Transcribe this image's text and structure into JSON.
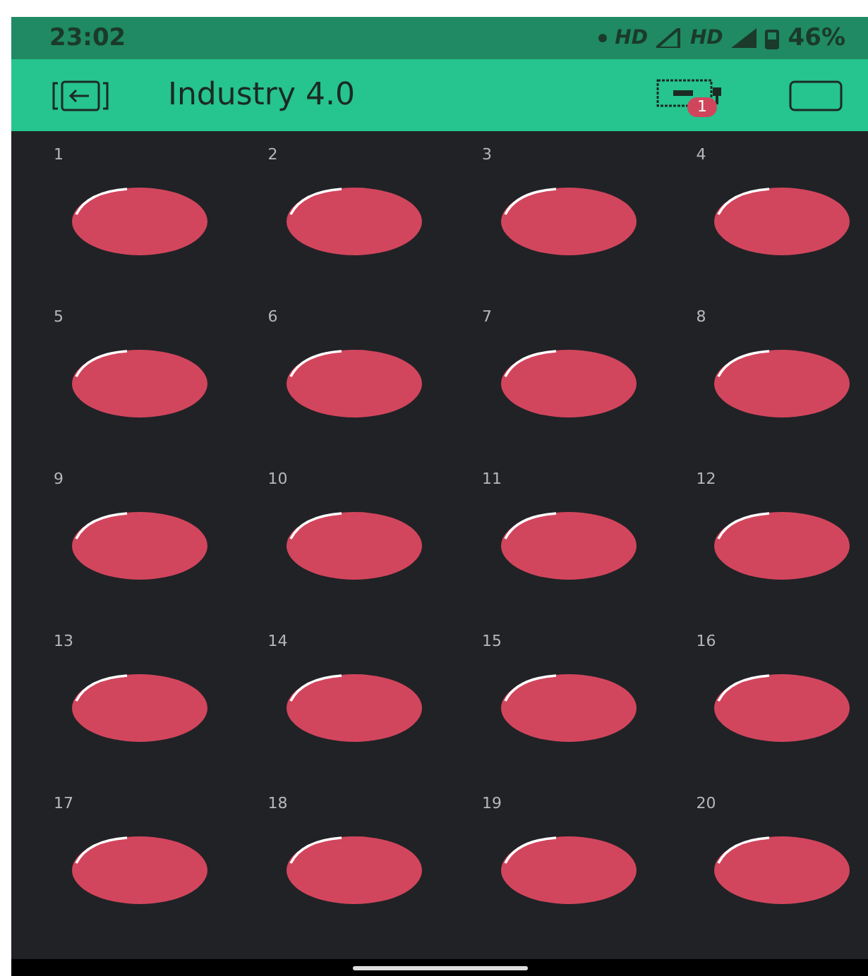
{
  "status_bar": {
    "time": "23:02",
    "network_1": "HD",
    "network_2": "HD",
    "battery": "46%"
  },
  "header": {
    "title": "Industry 4.0",
    "badge": "1"
  },
  "buttons": [
    {
      "label": "1"
    },
    {
      "label": "2"
    },
    {
      "label": "3"
    },
    {
      "label": "4"
    },
    {
      "label": "5"
    },
    {
      "label": "6"
    },
    {
      "label": "7"
    },
    {
      "label": "8"
    },
    {
      "label": "9"
    },
    {
      "label": "10"
    },
    {
      "label": "11"
    },
    {
      "label": "12"
    },
    {
      "label": "13"
    },
    {
      "label": "14"
    },
    {
      "label": "15"
    },
    {
      "label": "16"
    },
    {
      "label": "17"
    },
    {
      "label": "18"
    },
    {
      "label": "19"
    },
    {
      "label": "20"
    }
  ]
}
